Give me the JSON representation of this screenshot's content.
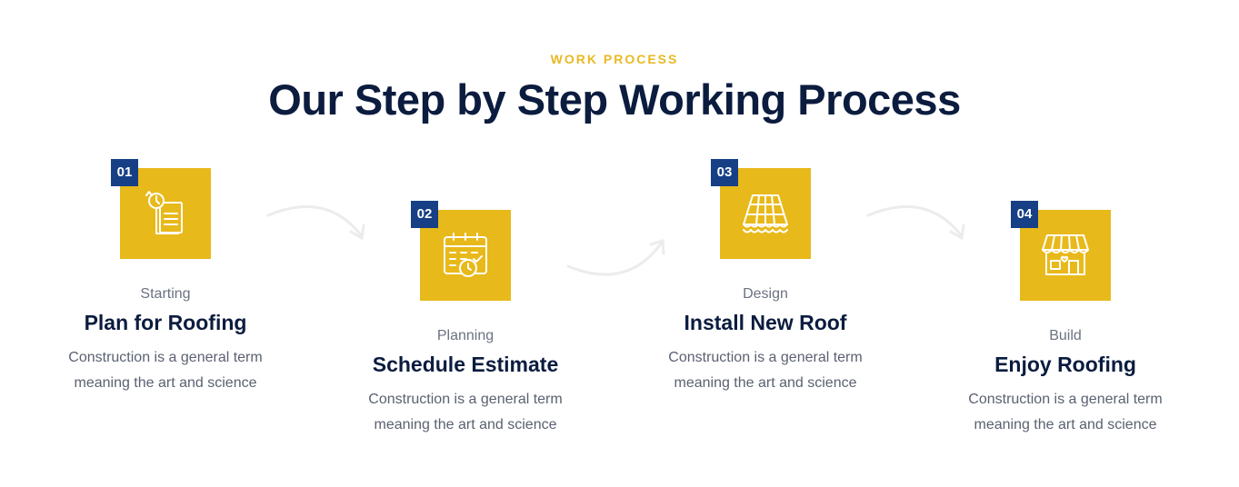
{
  "section": {
    "eyebrow": "WORK PROCESS",
    "heading": "Our Step by Step Working Process"
  },
  "steps": [
    {
      "number": "01",
      "subtitle": "Starting",
      "title": "Plan for Roofing",
      "desc_line1": "Construction is a general term",
      "desc_line2": "meaning the art and science",
      "icon": "documents-clock-icon"
    },
    {
      "number": "02",
      "subtitle": "Planning",
      "title": "Schedule Estimate",
      "desc_line1": "Construction is a general term",
      "desc_line2": "meaning the art and science",
      "icon": "calendar-clock-icon"
    },
    {
      "number": "03",
      "subtitle": "Design",
      "title": "Install New Roof",
      "desc_line1": "Construction is a general term",
      "desc_line2": "meaning the art and science",
      "icon": "roof-tiles-icon"
    },
    {
      "number": "04",
      "subtitle": "Build",
      "title": "Enjoy Roofing",
      "desc_line1": "Construction is a general term",
      "desc_line2": "meaning the art and science",
      "icon": "storefront-icon"
    }
  ],
  "colors": {
    "accent": "#e8b91a",
    "badge": "#163f85",
    "heading": "#0b1c3f",
    "text": "#5a6170"
  }
}
